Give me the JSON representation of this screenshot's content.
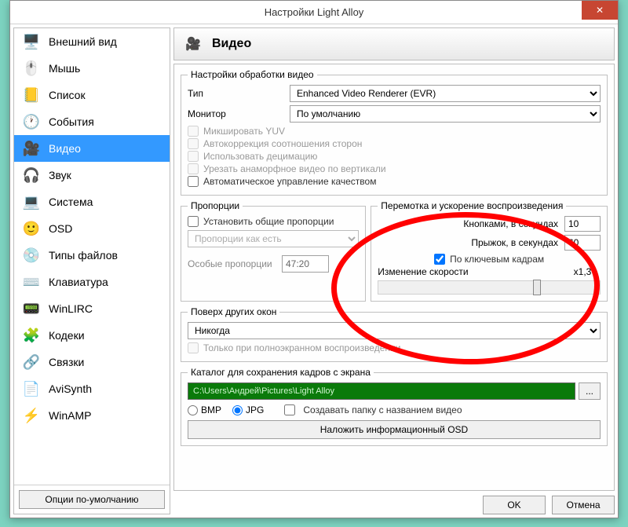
{
  "window": {
    "title": "Настройки Light Alloy"
  },
  "sidebar": {
    "items": [
      {
        "icon": "🖥️",
        "label": "Внешний вид"
      },
      {
        "icon": "🖱️",
        "label": "Мышь"
      },
      {
        "icon": "📒",
        "label": "Список"
      },
      {
        "icon": "🕐",
        "label": "События"
      },
      {
        "icon": "🎥",
        "label": "Видео"
      },
      {
        "icon": "🎧",
        "label": "Звук"
      },
      {
        "icon": "💻",
        "label": "Система"
      },
      {
        "icon": "🙂",
        "label": "OSD"
      },
      {
        "icon": "💿",
        "label": "Типы файлов"
      },
      {
        "icon": "⌨️",
        "label": "Клавиатура"
      },
      {
        "icon": "📟",
        "label": "WinLIRC"
      },
      {
        "icon": "🧩",
        "label": "Кодеки"
      },
      {
        "icon": "🔗",
        "label": "Связки"
      },
      {
        "icon": "📄",
        "label": "AviSynth"
      },
      {
        "icon": "⚡",
        "label": "WinAMP"
      }
    ],
    "selected_index": 4,
    "defaults_btn": "Опции по-умолчанию"
  },
  "header": {
    "icon": "🎥",
    "title": "Видео"
  },
  "processing": {
    "legend": "Настройки обработки видео",
    "type_label": "Тип",
    "type_value": "Enhanced Video Renderer (EVR)",
    "monitor_label": "Монитор",
    "monitor_value": "По умолчанию",
    "chk_mix_yuv": "Микшировать YUV",
    "chk_autocorr": "Автокоррекция соотношения сторон",
    "chk_decimation": "Использовать децимацию",
    "chk_crop_anam": "Урезать анаморфное видео по вертикали",
    "chk_auto_quality": "Автоматическое управление качеством"
  },
  "proportions": {
    "legend": "Пропорции",
    "chk_set_common": "Установить общие пропорции",
    "dropdown_value": "Пропорции как есть",
    "special_label": "Особые пропорции",
    "special_value": "47:20"
  },
  "seek": {
    "legend": "Перемотка и ускорение воспроизведения",
    "buttons_label": "Кнопками, в секундах",
    "buttons_value": "10",
    "jump_label": "Прыжок, в секундах",
    "jump_value": "60",
    "chk_keyframes": "По ключевым кадрам",
    "speed_label": "Изменение скорости",
    "speed_value": "x1,3"
  },
  "ontop": {
    "legend": "Поверх других окон",
    "value": "Никогда",
    "chk_fullscreen_only": "Только при полноэкранном воспроизведении"
  },
  "snapshot": {
    "legend": "Каталог для сохранения кадров с экрана",
    "path": "C:\\Users\\Андрей\\Pictures\\Light Alloy",
    "browse": "...",
    "radio_bmp": "BMP",
    "radio_jpg": "JPG",
    "chk_folder": "Создавать папку с названием видео",
    "osd_btn": "Наложить информационный OSD"
  },
  "footer": {
    "ok": "OK",
    "cancel": "Отмена"
  }
}
